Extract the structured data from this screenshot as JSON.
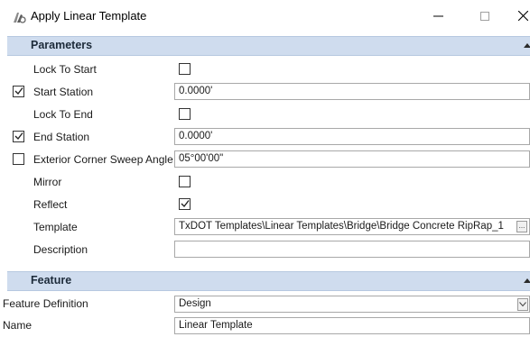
{
  "window": {
    "title": "Apply Linear Template",
    "app_icon": "linear-template-icon",
    "controls": [
      "minimize-icon",
      "maximize-icon",
      "close-icon"
    ]
  },
  "parameters": {
    "header": "Parameters",
    "rows": [
      {
        "label": "Lock To Start",
        "enabled": null,
        "type": "checkbox",
        "checked": false
      },
      {
        "label": "Start Station",
        "enabled": true,
        "type": "text",
        "value": "0.0000'"
      },
      {
        "label": "Lock To End",
        "enabled": null,
        "type": "checkbox",
        "checked": false
      },
      {
        "label": "End Station",
        "enabled": true,
        "type": "text",
        "value": "0.0000'"
      },
      {
        "label": "Exterior Corner Sweep Angle",
        "enabled": false,
        "type": "text",
        "value": "05°00'00\""
      },
      {
        "label": "Mirror",
        "enabled": null,
        "type": "checkbox",
        "checked": false
      },
      {
        "label": "Reflect",
        "enabled": null,
        "type": "checkbox",
        "checked": true
      },
      {
        "label": "Template",
        "enabled": null,
        "type": "text",
        "value": "TxDOT Templates\\Linear Templates\\Bridge\\Bridge Concrete RipRap_1",
        "button": "..."
      },
      {
        "label": "Description",
        "enabled": null,
        "type": "text",
        "value": ""
      }
    ]
  },
  "feature": {
    "header": "Feature",
    "feature_definition": {
      "label": "Feature Definition",
      "value": "Design"
    },
    "name": {
      "label": "Name",
      "value": "Linear Template"
    }
  },
  "colors": {
    "section_header_bg": "#cfdcee",
    "section_header_text": "#1d2b3a"
  }
}
